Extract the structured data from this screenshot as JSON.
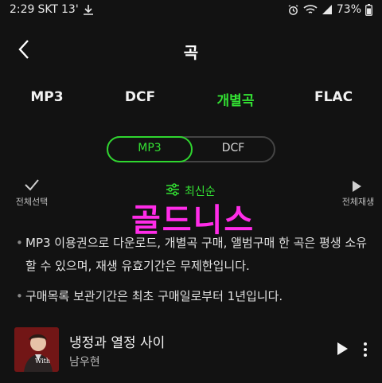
{
  "status": {
    "time": "2:29",
    "carrier": "SKT",
    "extra": "13'",
    "battery": "73%"
  },
  "header": {
    "title": "곡"
  },
  "tabs": [
    {
      "label": "MP3",
      "active": false
    },
    {
      "label": "DCF",
      "active": false
    },
    {
      "label": "개별곡",
      "active": true
    },
    {
      "label": "FLAC",
      "active": false
    }
  ],
  "segment": {
    "options": [
      "MP3",
      "DCF"
    ],
    "selected": "MP3"
  },
  "actions": {
    "select_all": "전체선택",
    "sort": "최신순",
    "play_all": "전체재생"
  },
  "watermark": "골드니스",
  "notices": [
    "MP3 이용권으로 다운로드, 개별곡 구매, 앨범구매 한 곡은 평생 소유할 수 있으며, 재생 유효기간은 무제한입니다.",
    "구매목록 보관기간은 최초 구매일로부터 1년입니다."
  ],
  "song": {
    "title": "냉정과 열정 사이",
    "artist": "남우현",
    "art_text": "With"
  },
  "colors": {
    "accent": "#33e033",
    "background": "#121212",
    "watermark": "#ff2ce8"
  }
}
